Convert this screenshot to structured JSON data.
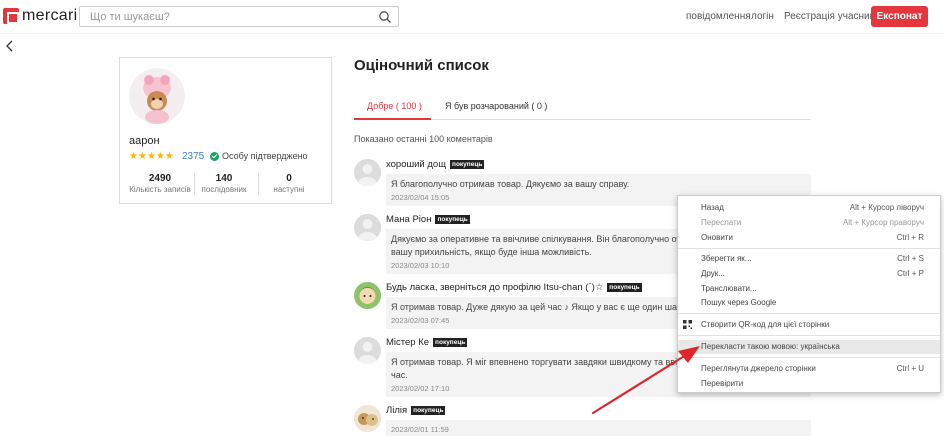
{
  "header": {
    "logo_text": "mercari",
    "search_placeholder": "Що ти шукаєш?",
    "nav": [
      "повідомлення",
      "логін",
      "Реєстрація учасників"
    ],
    "exhibit_label": "Експонат",
    "accent_color": "#e4363d"
  },
  "profile": {
    "name": "аарон",
    "rating_stars": 5,
    "stars_text": "★★★★★",
    "rating_count": "2375",
    "verified_label": "Особу підтверджено",
    "stats": [
      {
        "value": "2490",
        "label": "Кількість записів"
      },
      {
        "value": "140",
        "label": "послідовник"
      },
      {
        "value": "0",
        "label": "наступні"
      }
    ]
  },
  "main": {
    "title": "Оціночний список",
    "tabs": [
      {
        "label": "Добре ( 100 )",
        "active": true
      },
      {
        "label": "Я був розчарований ( 0 )",
        "active": false
      }
    ],
    "shown_text": "Показано останні 100 коментарів"
  },
  "reviews": [
    {
      "name": "хороший дощ",
      "badge": "покупець",
      "text": "Я благополучно отримав товар. Дякуємо за вашу справу.",
      "date": "2023/02/04 15:05"
    },
    {
      "name": "Мана Ріон",
      "badge": "покупець",
      "text": "Дякуємо за оперативне та ввічливе спілкування. Він благополучно отри",
      "text2": "вашу прихильність, якщо буде інша можливість.",
      "date": "2023/02/03 10:10"
    },
    {
      "name": "Будь ласка, зверніться до профілю Itsu-chan (´)☆",
      "badge": "покупець",
      "text": "Я отримав товар. Дуже дякую за цей час ♪ Якщо у вас є ще один шанс,",
      "date": "2023/02/03 07:45"
    },
    {
      "name": "Містер Ке",
      "badge": "покупець",
      "text": "Я отримав товар. Я міг впевнено торгувати завдяки швидкому та ввічли",
      "text2": "час.",
      "date": "2023/02/02 17:10"
    },
    {
      "name": "Лілія",
      "badge": "покупець",
      "text": "",
      "date": "2023/02/01 11:59"
    }
  ],
  "context_menu": {
    "items": [
      {
        "label": "Назад",
        "shortcut": "Alt + Курсор ліворуч",
        "disabled": false
      },
      {
        "label": "Переслати",
        "shortcut": "Alt + Курсор праворуч",
        "disabled": true
      },
      {
        "label": "Оновити",
        "shortcut": "Ctrl + R",
        "disabled": false
      },
      {
        "label": "Зберегти як...",
        "shortcut": "Ctrl + S",
        "disabled": false
      },
      {
        "label": "Друк...",
        "shortcut": "Ctrl + P",
        "disabled": false
      },
      {
        "label": "Транслювати...",
        "shortcut": "",
        "disabled": false
      },
      {
        "label": "Пошук через Google",
        "shortcut": "",
        "disabled": false
      },
      {
        "label": "Створити QR-код для цієї сторінки",
        "shortcut": "",
        "disabled": false,
        "icon": "qr-code-icon"
      },
      {
        "label": "Перекласти такою мовою: українська",
        "shortcut": "",
        "disabled": false,
        "highlighted": true
      },
      {
        "label": "Переглянути джерело сторінки",
        "shortcut": "Ctrl + U",
        "disabled": false
      },
      {
        "label": "Перевірити",
        "shortcut": "",
        "disabled": false
      }
    ]
  },
  "annotation": {
    "arrow_color": "#e0252b"
  }
}
